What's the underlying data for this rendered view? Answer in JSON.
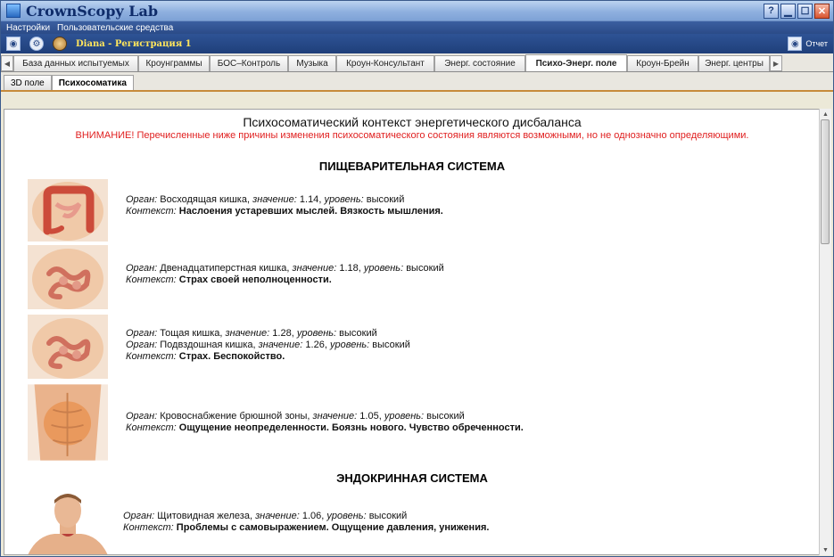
{
  "window": {
    "title": "CrownScopy Lab",
    "help_label": "?"
  },
  "menu": [
    "Настройки",
    "Пользовательские средства"
  ],
  "userbar": {
    "user": "Diana",
    "separator": " - ",
    "session": "Регистрация 1",
    "report_label": "Отчет"
  },
  "tabs": [
    {
      "label": "База данных испытуемых",
      "active": false
    },
    {
      "label": "Кроунграммы",
      "active": false
    },
    {
      "label": "БОС–Контроль",
      "active": false
    },
    {
      "label": "Музыка",
      "active": false
    },
    {
      "label": "Кроун-Консультант",
      "active": false
    },
    {
      "label": "Энерг. состояние",
      "active": false
    },
    {
      "label": "Психо-Энерг. поле",
      "active": true
    },
    {
      "label": "Кроун-Брейн",
      "active": false
    },
    {
      "label": "Энерг. центры",
      "active": false
    }
  ],
  "subtabs": [
    {
      "label": "3D поле",
      "active": false
    },
    {
      "label": "Психосоматика",
      "active": true
    }
  ],
  "content": {
    "title": "Психосоматический контекст энергетического дисбаланса",
    "warning": "ВНИМАНИЕ! Перечисленные ниже причины изменения психосоматического состояния являются возможными, но не однозначно определяющими.",
    "labels": {
      "organ": "Орган:",
      "value": "значение:",
      "level": "уровень:",
      "context": "Контекст:"
    },
    "sections": [
      {
        "title": "ПИЩЕВАРИТЕЛЬНАЯ СИСТЕМА",
        "entries": [
          {
            "image": "colon-icon",
            "organs": [
              {
                "name": "Восходящая кишка",
                "value": "1.14",
                "level": "высокий"
              }
            ],
            "context": "Наслоения устаревших мыслей. Вязкость мышления."
          },
          {
            "image": "intestine-icon",
            "organs": [
              {
                "name": "Двенадцатиперстная кишка",
                "value": "1.18",
                "level": "высокий"
              }
            ],
            "context": "Страх своей неполноценности."
          },
          {
            "image": "intestine-icon",
            "organs": [
              {
                "name": "Тощая кишка",
                "value": "1.28",
                "level": "высокий"
              },
              {
                "name": "Подвздошная кишка",
                "value": "1.26",
                "level": "высокий"
              }
            ],
            "context": "Страх. Беспокойство."
          },
          {
            "image": "abdomen-icon",
            "organs": [
              {
                "name": "Кровоснабжение брюшной зоны",
                "value": "1.05",
                "level": "высокий"
              }
            ],
            "context": "Ощущение неопределенности. Боязнь нового. Чувство обреченности."
          }
        ]
      },
      {
        "title": "ЭНДОКРИННАЯ СИСТЕМА",
        "entries": [
          {
            "image": "thyroid-icon",
            "organs": [
              {
                "name": "Щитовидная железа",
                "value": "1.06",
                "level": "высокий"
              }
            ],
            "context": "Проблемы с самовыражением. Ощущение давления, унижения."
          }
        ]
      }
    ]
  },
  "colors": {
    "title_bar": "#8fb0df",
    "menu_bar": "#2b4b88",
    "warning": "#e02020",
    "username": "#ffe55c"
  }
}
